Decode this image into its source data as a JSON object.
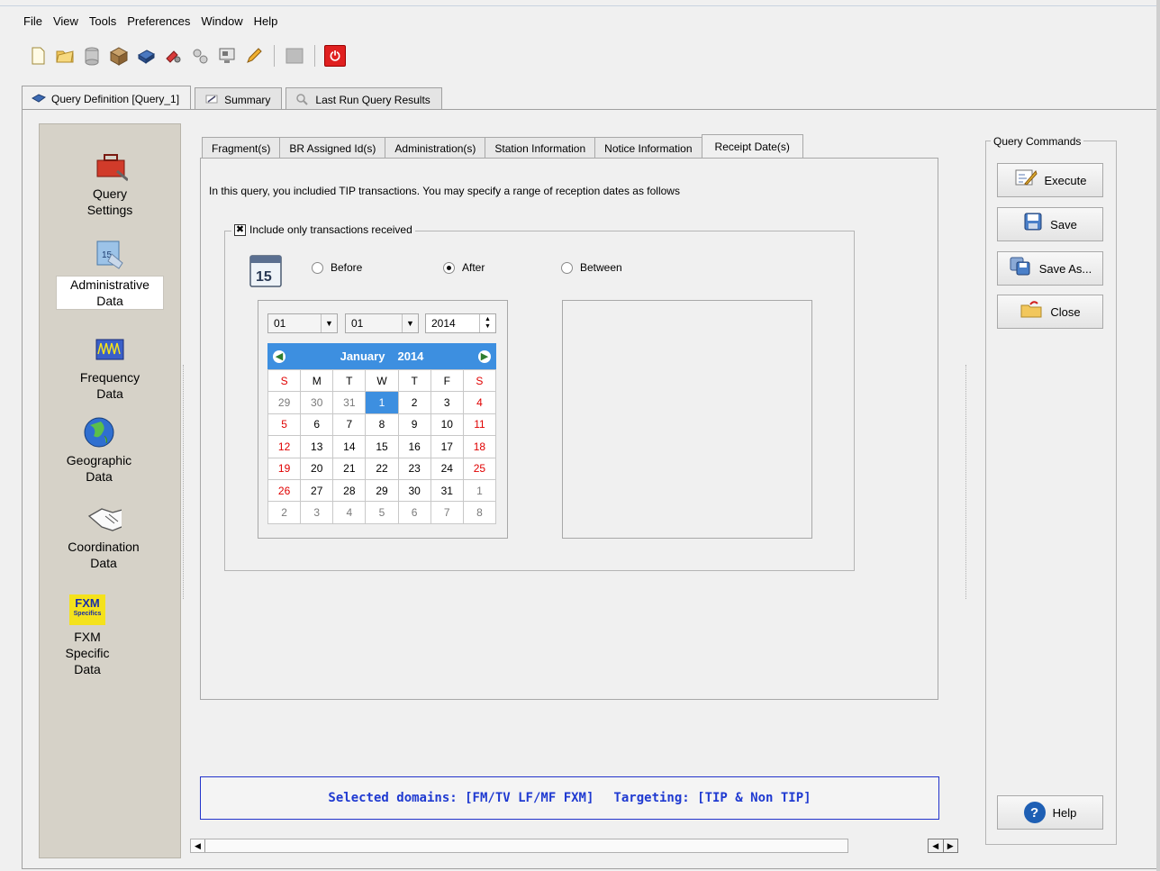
{
  "menu": [
    "File",
    "View",
    "Tools",
    "Preferences",
    "Window",
    "Help"
  ],
  "toolbar_icons": [
    "new-file-icon",
    "open-folder-icon",
    "database-icon",
    "package-icon",
    "printer-icon",
    "tools-icon",
    "settings-icon",
    "monitor-icon",
    "pencil-icon",
    "disabled-icon",
    "power-icon"
  ],
  "main_tabs": [
    {
      "label": "Query Definition [Query_1]",
      "icon": "query-icon",
      "active": true
    },
    {
      "label": "Summary",
      "icon": "summary-icon",
      "active": false
    },
    {
      "label": "Last Run Query Results",
      "icon": "results-icon",
      "active": false
    }
  ],
  "nav": [
    {
      "line1": "Query",
      "line2": "Settings",
      "icon": "toolbox-icon"
    },
    {
      "line1": "Administrative",
      "line2": "Data",
      "icon": "calendar-doc-icon",
      "selected": true
    },
    {
      "line1": "Frequency",
      "line2": "Data",
      "icon": "frequency-icon"
    },
    {
      "line1": "Geographic",
      "line2": "Data",
      "icon": "globe-icon"
    },
    {
      "line1": "Coordination",
      "line2": "Data",
      "icon": "handshake-icon"
    },
    {
      "line1": "FXM",
      "line2": "Specific",
      "line3": "Data",
      "icon": "fxm-icon"
    }
  ],
  "fxm_logo": {
    "main": "FXM",
    "sub": "Specifics"
  },
  "sub_tabs": [
    "Fragment(s)",
    "BR Assigned Id(s)",
    "Administration(s)",
    "Station Information",
    "Notice Information",
    "Receipt Date(s)"
  ],
  "active_sub_tab": "Receipt Date(s)",
  "info_text": "In this query, you includied TIP transactions. You may specify a range of reception dates as follows",
  "group": {
    "title": "Include only transactions received",
    "checked": true,
    "options": [
      "Before",
      "After",
      "Between"
    ],
    "selected": "After"
  },
  "calendar": {
    "month_combo": "01",
    "day_combo": "01",
    "year_spin": "2014",
    "month": "January",
    "year": "2014",
    "weekdays": [
      "S",
      "M",
      "T",
      "W",
      "T",
      "F",
      "S"
    ],
    "weeks": [
      [
        "29",
        "30",
        "31",
        "1",
        "2",
        "3",
        "4"
      ],
      [
        "5",
        "6",
        "7",
        "8",
        "9",
        "10",
        "11"
      ],
      [
        "12",
        "13",
        "14",
        "15",
        "16",
        "17",
        "18"
      ],
      [
        "19",
        "20",
        "21",
        "22",
        "23",
        "24",
        "25"
      ],
      [
        "26",
        "27",
        "28",
        "29",
        "30",
        "31",
        "1"
      ],
      [
        "2",
        "3",
        "4",
        "5",
        "6",
        "7",
        "8"
      ]
    ],
    "selected_day": "1"
  },
  "status": {
    "domains": "Selected domains: [FM/TV  LF/MF  FXM]",
    "targeting": "Targeting: [TIP  &  Non TIP]"
  },
  "commands": {
    "title": "Query Commands",
    "execute": "Execute",
    "save": "Save",
    "save_as": "Save As...",
    "close": "Close",
    "help": "Help"
  },
  "colors": {
    "calendar_header": "#3d8fe0",
    "weekend": "#e00000",
    "status_text": "#1f3ad1",
    "nav_background": "#d6d2c8"
  }
}
